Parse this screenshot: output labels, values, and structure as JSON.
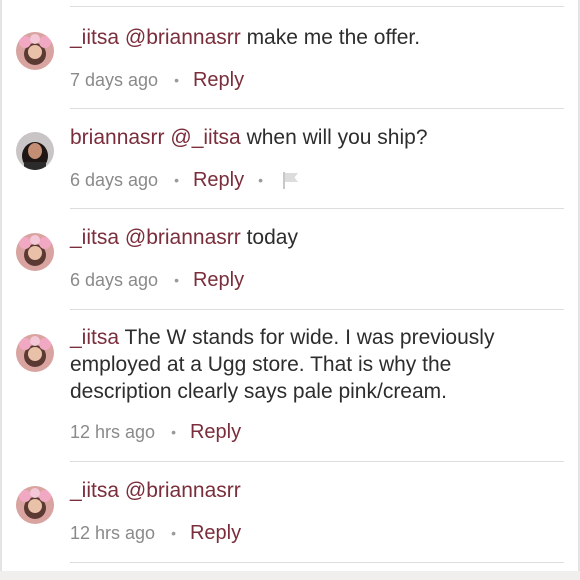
{
  "comments": [
    {
      "username": "_iitsa",
      "mention": "@briannasrr",
      "text": " make me the offer.",
      "time": "7 days ago",
      "reply_label": "Reply",
      "avatar": "avatar-pink-bow"
    },
    {
      "username": "briannasrr",
      "mention": "@_iitsa",
      "text": " when will  you ship?",
      "time": "6 days ago",
      "reply_label": "Reply",
      "avatar": "avatar-dark-hair",
      "has_flag": true
    },
    {
      "username": "_iitsa",
      "mention": "@briannasrr",
      "text": " today",
      "time": "6 days ago",
      "reply_label": "Reply",
      "avatar": "avatar-pink-bow"
    },
    {
      "username": "_iitsa",
      "mention": "",
      "text": "  The W stands for wide. I was previously employed at a Ugg store. That is why the description clearly says pale pink/cream.",
      "time": "12 hrs ago",
      "reply_label": "Reply",
      "avatar": "avatar-pink-bow"
    },
    {
      "username": "_iitsa",
      "mention": "@briannasrr",
      "text": "",
      "time": "12 hrs ago",
      "reply_label": "Reply",
      "avatar": "avatar-pink-bow"
    }
  ],
  "colors": {
    "accent": "#7a2d3a",
    "text": "#2d2d2d",
    "muted": "#8a8a8a"
  }
}
